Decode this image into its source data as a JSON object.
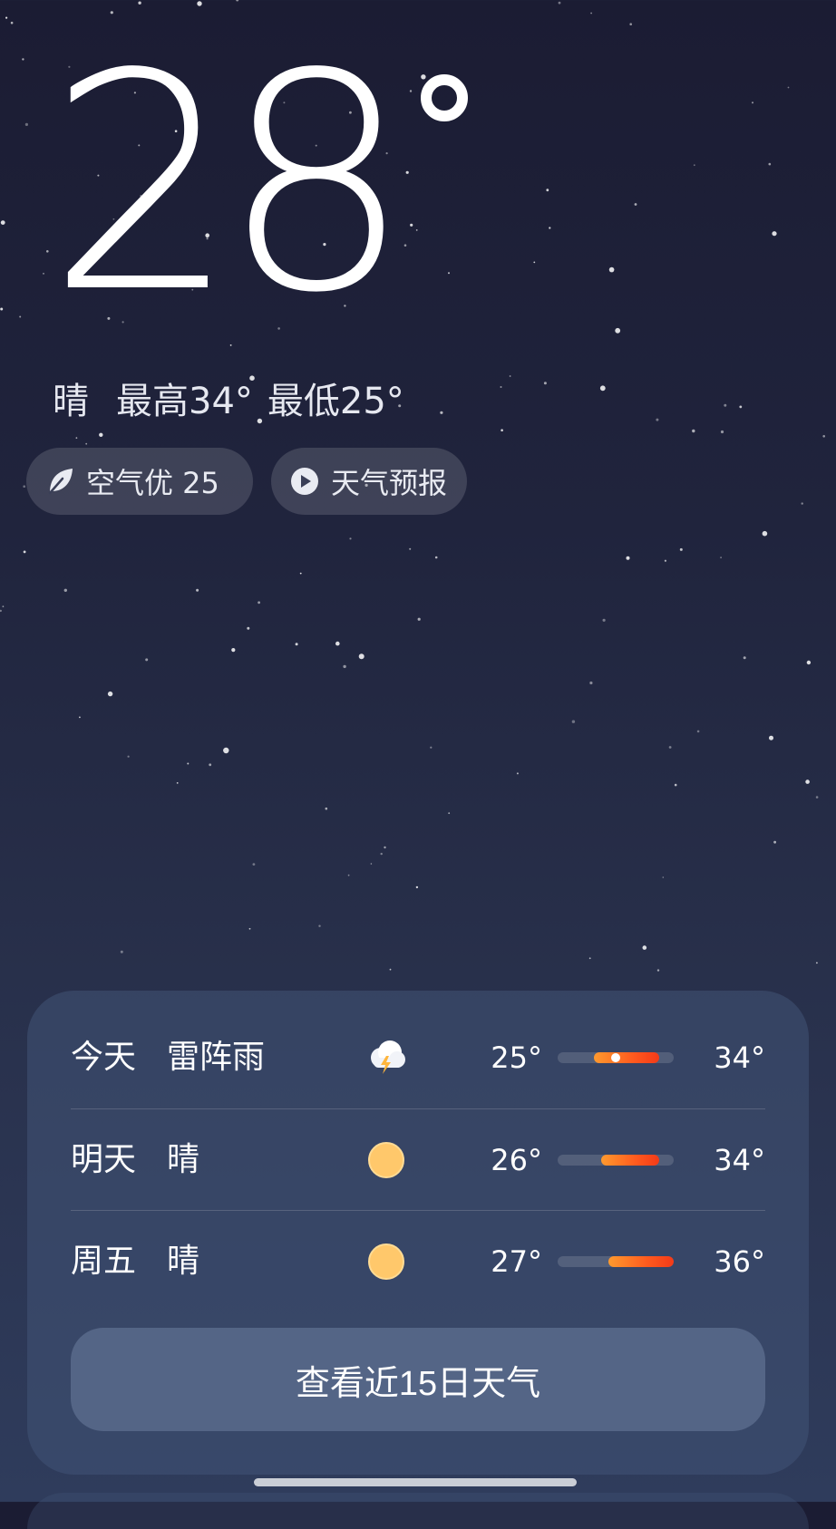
{
  "current": {
    "temperature": "28",
    "condition": "晴",
    "high": "最高34°",
    "low": "最低25°"
  },
  "chips": {
    "aqi_label": "空气优 25",
    "aqi_icon": "leaf-icon",
    "forecast_label": "天气预报",
    "forecast_icon": "play-circle-icon"
  },
  "daily": [
    {
      "day": "今天",
      "condition": "雷阵雨",
      "icon": "thunderstorm-icon",
      "low": "25°",
      "high": "34°",
      "low_value": 25,
      "high_value": 34,
      "current_value": 28
    },
    {
      "day": "明天",
      "condition": "晴",
      "icon": "sun-icon",
      "low": "26°",
      "high": "34°",
      "low_value": 26,
      "high_value": 34
    },
    {
      "day": "周五",
      "condition": "晴",
      "icon": "sun-icon",
      "low": "27°",
      "high": "36°",
      "low_value": 27,
      "high_value": 36
    }
  ],
  "range_scale": {
    "min": 20,
    "max": 36
  },
  "cta_label": "查看近15日天气",
  "colors": {
    "sun": "#ffc86b",
    "bar_start": "#ff9a2e",
    "bar_end": "#f33a18"
  }
}
